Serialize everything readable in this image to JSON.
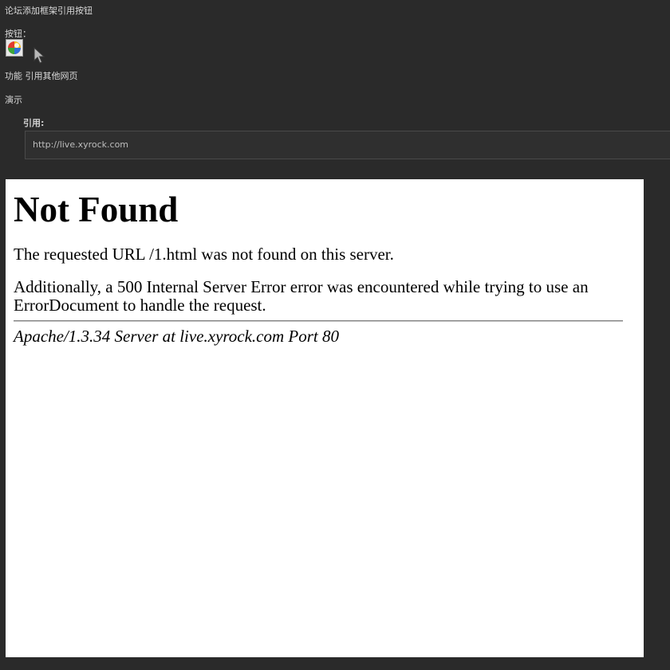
{
  "post": {
    "title": "论坛添加框架引用按钮",
    "button_label": "按钮：",
    "function_label": "功能",
    "function_desc": "引用其他网页",
    "demo_label": "演示"
  },
  "quote": {
    "label": "引用:",
    "url": "http://live.xyrock.com"
  },
  "icons": {
    "frame_button": "colorful-frame-icon",
    "cursor": "mouse-pointer-icon"
  },
  "embedded_page": {
    "heading": "Not Found",
    "message": "The requested URL /1.html was not found on this server.",
    "additional": "Additionally, a 500 Internal Server Error error was encountered while trying to use an ErrorDocument to handle the request.",
    "address": "Apache/1.3.34 Server at live.xyrock.com Port 80"
  },
  "colors": {
    "background": "#2a2a2a",
    "text": "#d8d8d8",
    "frame_background": "#ffffff"
  }
}
